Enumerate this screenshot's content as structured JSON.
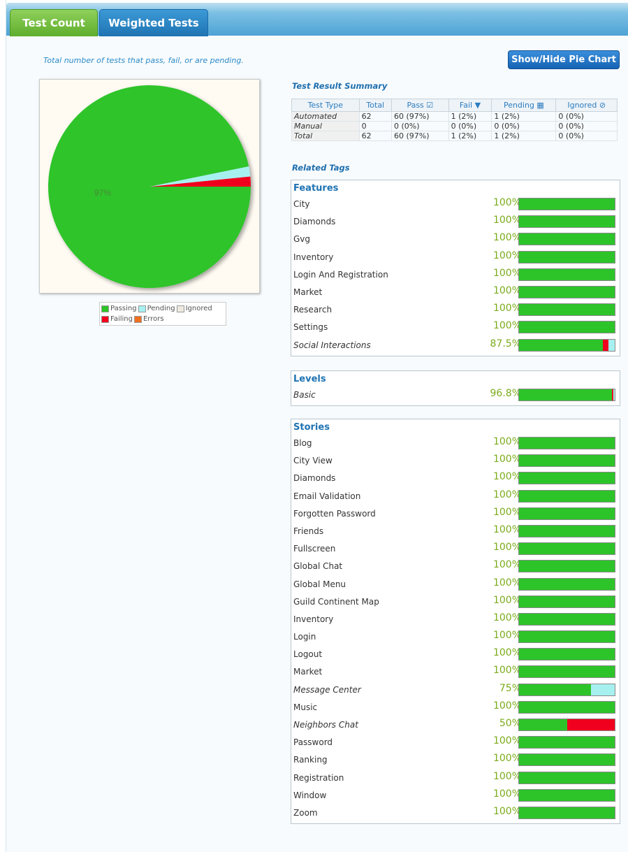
{
  "tabs": [
    {
      "label": "Test Count"
    },
    {
      "label": "Weighted Tests"
    }
  ],
  "subtitle": "Total number of tests that pass, fail, or are pending.",
  "toggle_button": "Show/Hide Pie Chart",
  "colors": {
    "pass": "#2dc42a",
    "pending": "#a7f0f0",
    "fail": "#f0001e",
    "ignored": "#eeeae0",
    "errors": "#f07020"
  },
  "pie": {
    "label": "97%",
    "slices": [
      {
        "name": "Passing",
        "pct": 96.8
      },
      {
        "name": "Pending",
        "pct": 1.6
      },
      {
        "name": "Failing",
        "pct": 1.6
      }
    ]
  },
  "legend": [
    [
      {
        "key": "pass",
        "label": "Passing"
      },
      {
        "key": "pending",
        "label": "Pending"
      },
      {
        "key": "ignored",
        "label": "Ignored"
      }
    ],
    [
      {
        "key": "fail",
        "label": "Failing"
      },
      {
        "key": "errors",
        "label": "Errors"
      }
    ]
  ],
  "summary": {
    "title": "Test Result Summary",
    "headers": [
      "Test Type",
      "Total",
      "Pass",
      "Fail",
      "Pending",
      "Ignored"
    ],
    "header_icons": [
      "",
      "",
      "check-square-icon",
      "thumbs-down-icon",
      "calendar-icon",
      "ban-icon"
    ],
    "rows": [
      [
        "Automated",
        "62",
        "60 (97%)",
        "1 (2%)",
        "1 (2%)",
        "0 (0%)"
      ],
      [
        "Manual",
        "0",
        "0 (0%)",
        "0 (0%)",
        "0 (0%)",
        "0 (0%)"
      ],
      [
        "Total",
        "62",
        "60 (97%)",
        "1 (2%)",
        "1 (2%)",
        "0 (0%)"
      ]
    ]
  },
  "related_tags_title": "Related Tags",
  "panels": [
    {
      "id": "features",
      "title": "Features",
      "items": [
        {
          "label": "City",
          "pct": "100%",
          "pass": 100,
          "fail": 0,
          "pending": 0,
          "italic": false
        },
        {
          "label": "Diamonds",
          "pct": "100%",
          "pass": 100,
          "fail": 0,
          "pending": 0,
          "italic": false
        },
        {
          "label": "Gvg",
          "pct": "100%",
          "pass": 100,
          "fail": 0,
          "pending": 0,
          "italic": false
        },
        {
          "label": "Inventory",
          "pct": "100%",
          "pass": 100,
          "fail": 0,
          "pending": 0,
          "italic": false
        },
        {
          "label": "Login And Registration",
          "pct": "100%",
          "pass": 100,
          "fail": 0,
          "pending": 0,
          "italic": false
        },
        {
          "label": "Market",
          "pct": "100%",
          "pass": 100,
          "fail": 0,
          "pending": 0,
          "italic": false
        },
        {
          "label": "Research",
          "pct": "100%",
          "pass": 100,
          "fail": 0,
          "pending": 0,
          "italic": false
        },
        {
          "label": "Settings",
          "pct": "100%",
          "pass": 100,
          "fail": 0,
          "pending": 0,
          "italic": false
        },
        {
          "label": "Social Interactions",
          "pct": "87.5%",
          "pass": 87.5,
          "fail": 6.25,
          "pending": 6.25,
          "italic": true
        }
      ]
    },
    {
      "id": "levels",
      "title": "Levels",
      "items": [
        {
          "label": "Basic",
          "pct": "96.8%",
          "pass": 96.8,
          "fail": 1.6,
          "pending": 1.6,
          "italic": true
        }
      ]
    },
    {
      "id": "stories",
      "title": "Stories",
      "items": [
        {
          "label": "Blog",
          "pct": "100%",
          "pass": 100,
          "fail": 0,
          "pending": 0,
          "italic": false
        },
        {
          "label": "City View",
          "pct": "100%",
          "pass": 100,
          "fail": 0,
          "pending": 0,
          "italic": false
        },
        {
          "label": "Diamonds",
          "pct": "100%",
          "pass": 100,
          "fail": 0,
          "pending": 0,
          "italic": false
        },
        {
          "label": "Email Validation",
          "pct": "100%",
          "pass": 100,
          "fail": 0,
          "pending": 0,
          "italic": false
        },
        {
          "label": "Forgotten Password",
          "pct": "100%",
          "pass": 100,
          "fail": 0,
          "pending": 0,
          "italic": false
        },
        {
          "label": "Friends",
          "pct": "100%",
          "pass": 100,
          "fail": 0,
          "pending": 0,
          "italic": false
        },
        {
          "label": "Fullscreen",
          "pct": "100%",
          "pass": 100,
          "fail": 0,
          "pending": 0,
          "italic": false
        },
        {
          "label": "Global Chat",
          "pct": "100%",
          "pass": 100,
          "fail": 0,
          "pending": 0,
          "italic": false
        },
        {
          "label": "Global Menu",
          "pct": "100%",
          "pass": 100,
          "fail": 0,
          "pending": 0,
          "italic": false
        },
        {
          "label": "Guild Continent Map",
          "pct": "100%",
          "pass": 100,
          "fail": 0,
          "pending": 0,
          "italic": false
        },
        {
          "label": "Inventory",
          "pct": "100%",
          "pass": 100,
          "fail": 0,
          "pending": 0,
          "italic": false
        },
        {
          "label": "Login",
          "pct": "100%",
          "pass": 100,
          "fail": 0,
          "pending": 0,
          "italic": false
        },
        {
          "label": "Logout",
          "pct": "100%",
          "pass": 100,
          "fail": 0,
          "pending": 0,
          "italic": false
        },
        {
          "label": "Market",
          "pct": "100%",
          "pass": 100,
          "fail": 0,
          "pending": 0,
          "italic": false
        },
        {
          "label": "Message Center",
          "pct": "75%",
          "pass": 75,
          "fail": 0,
          "pending": 25,
          "italic": true
        },
        {
          "label": "Music",
          "pct": "100%",
          "pass": 100,
          "fail": 0,
          "pending": 0,
          "italic": false
        },
        {
          "label": "Neighbors Chat",
          "pct": "50%",
          "pass": 50,
          "fail": 50,
          "pending": 0,
          "italic": true
        },
        {
          "label": "Password",
          "pct": "100%",
          "pass": 100,
          "fail": 0,
          "pending": 0,
          "italic": false
        },
        {
          "label": "Ranking",
          "pct": "100%",
          "pass": 100,
          "fail": 0,
          "pending": 0,
          "italic": false
        },
        {
          "label": "Registration",
          "pct": "100%",
          "pass": 100,
          "fail": 0,
          "pending": 0,
          "italic": false
        },
        {
          "label": "Window",
          "pct": "100%",
          "pass": 100,
          "fail": 0,
          "pending": 0,
          "italic": false
        },
        {
          "label": "Zoom",
          "pct": "100%",
          "pass": 100,
          "fail": 0,
          "pending": 0,
          "italic": false
        }
      ]
    }
  ]
}
